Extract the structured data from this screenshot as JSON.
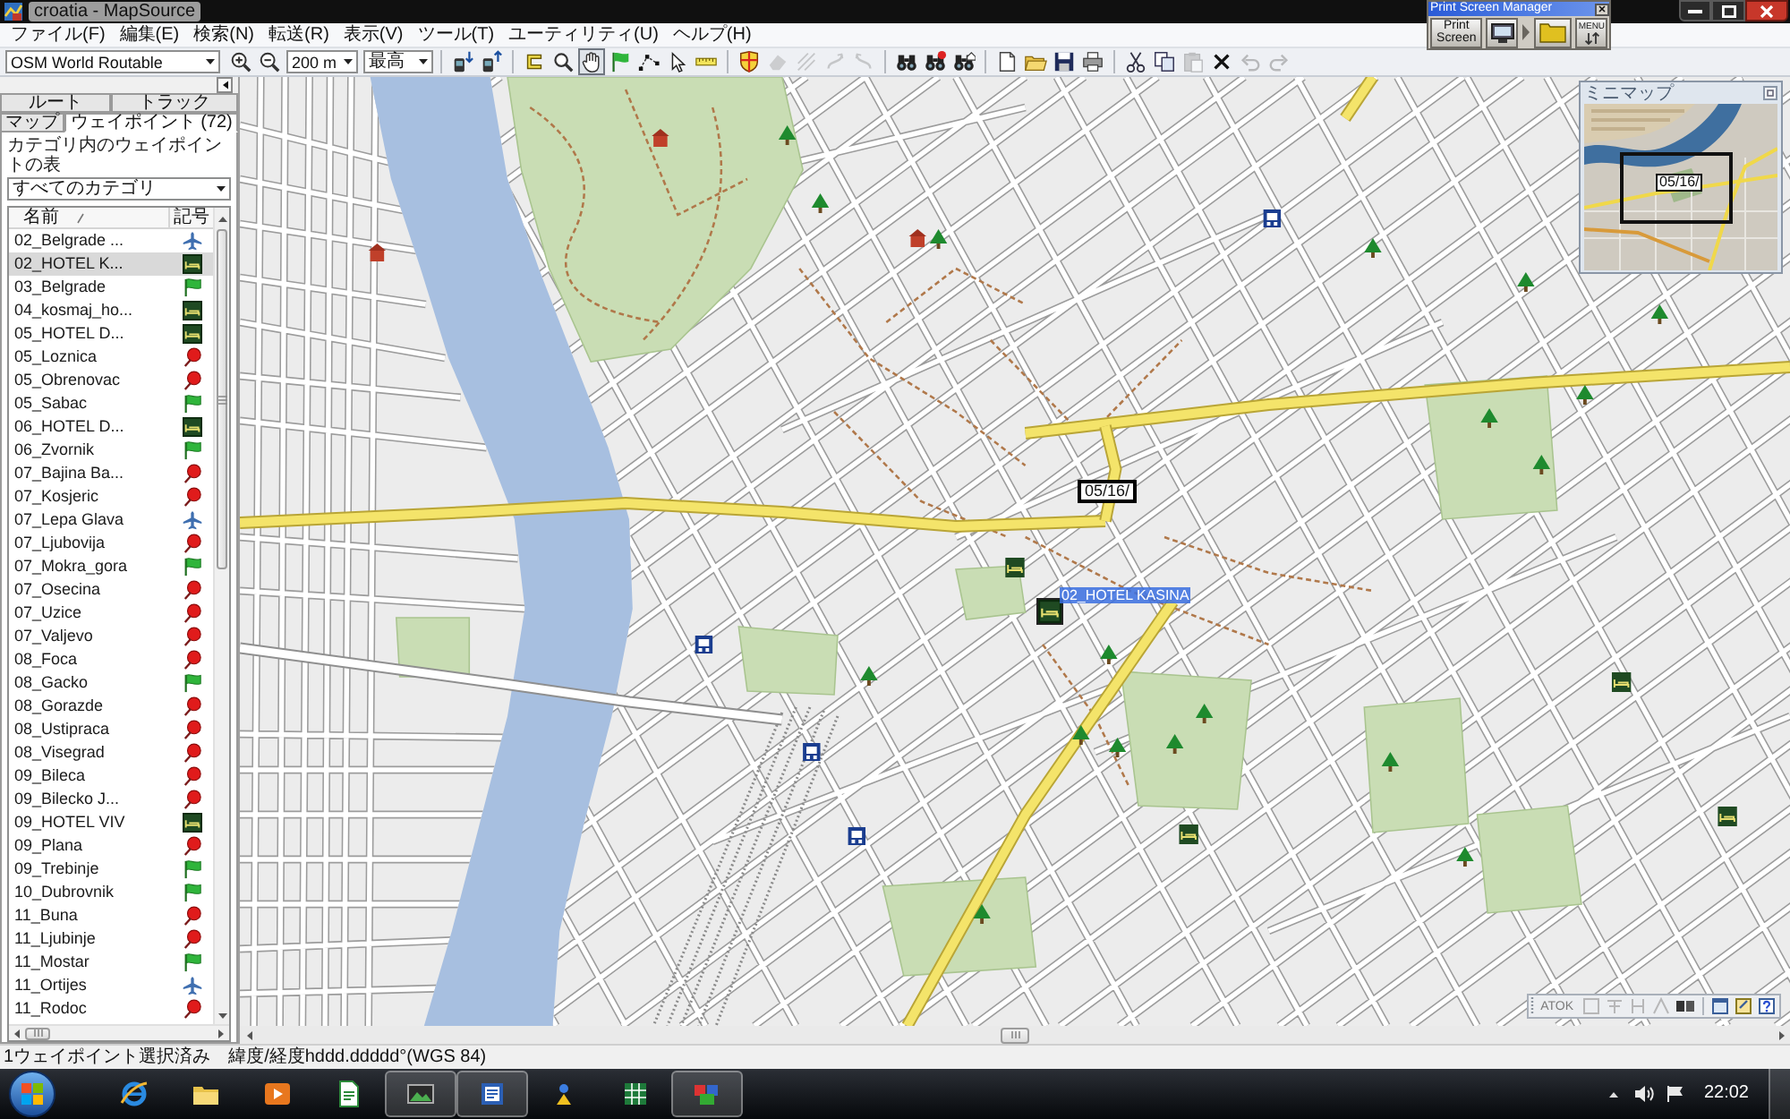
{
  "window": {
    "title": "croatia - MapSource"
  },
  "print_screen_manager": {
    "title": "Print Screen Manager",
    "button": "Print Screen",
    "menu_button": "MENU"
  },
  "menu": [
    "ファイル(F)",
    "編集(E)",
    "検索(N)",
    "転送(R)",
    "表示(V)",
    "ツール(T)",
    "ユーティリティ(U)",
    "ヘルプ(H)"
  ],
  "toolbar": {
    "map_product": "OSM World Routable",
    "zoom_scale": "200 m",
    "detail": "最高",
    "tools": [
      {
        "kind": "select",
        "selected": false
      },
      {
        "kind": "zoom",
        "selected": false
      },
      {
        "kind": "pan",
        "selected": true
      },
      {
        "kind": "waypoint",
        "selected": false
      },
      {
        "kind": "route",
        "selected": false
      },
      {
        "kind": "pointer",
        "selected": false
      },
      {
        "kind": "measure",
        "selected": false
      }
    ],
    "actions": [
      [
        {
          "kind": "map-select",
          "disabled": false
        },
        {
          "kind": "erase",
          "disabled": true
        },
        {
          "kind": "hatch",
          "disabled": true
        },
        {
          "kind": "curve",
          "disabled": true
        },
        {
          "kind": "curve-back",
          "disabled": true
        }
      ],
      [
        {
          "kind": "find",
          "disabled": false
        },
        {
          "kind": "find-place",
          "disabled": false
        },
        {
          "kind": "find-address",
          "disabled": false
        }
      ],
      [
        {
          "kind": "new",
          "disabled": false
        },
        {
          "kind": "open",
          "disabled": false
        },
        {
          "kind": "save",
          "disabled": false
        },
        {
          "kind": "print",
          "disabled": false
        }
      ],
      [
        {
          "kind": "cut",
          "disabled": false
        },
        {
          "kind": "copy",
          "disabled": false
        },
        {
          "kind": "paste",
          "disabled": true
        },
        {
          "kind": "delete",
          "disabled": false
        },
        {
          "kind": "undo",
          "disabled": true
        },
        {
          "kind": "redo",
          "disabled": true
        }
      ]
    ]
  },
  "sidebar": {
    "tabs": [
      [
        {
          "label": "ルート",
          "selected": false
        },
        {
          "label": "トラック",
          "selected": false
        }
      ],
      [
        {
          "label": "マップ",
          "selected": false
        },
        {
          "label": "ウェイポイント (72)",
          "selected": true
        }
      ]
    ],
    "category_label": "カテゴリ内のウェイポイントの表",
    "category": "すべてのカテゴリ",
    "columns": [
      "名前",
      "記号"
    ],
    "waypoints": [
      {
        "name": "02_Belgrade ...",
        "kind": "airport",
        "selected": false
      },
      {
        "name": "02_HOTEL K...",
        "kind": "lodging",
        "selected": true
      },
      {
        "name": "03_Belgrade",
        "kind": "flag",
        "selected": false
      },
      {
        "name": "04_kosmaj_ho...",
        "kind": "lodging",
        "selected": false
      },
      {
        "name": "05_HOTEL D...",
        "kind": "lodging",
        "selected": false
      },
      {
        "name": "05_Loznica",
        "kind": "pin",
        "selected": false
      },
      {
        "name": "05_Obrenovac",
        "kind": "pin",
        "selected": false
      },
      {
        "name": "05_Sabac",
        "kind": "flag",
        "selected": false
      },
      {
        "name": "06_HOTEL D...",
        "kind": "lodging",
        "selected": false
      },
      {
        "name": "06_Zvornik",
        "kind": "flag",
        "selected": false
      },
      {
        "name": "07_Bajina Ba...",
        "kind": "pin",
        "selected": false
      },
      {
        "name": "07_Kosjeric",
        "kind": "pin",
        "selected": false
      },
      {
        "name": "07_Lepa Glava",
        "kind": "airport",
        "selected": false
      },
      {
        "name": "07_Ljubovija",
        "kind": "pin",
        "selected": false
      },
      {
        "name": "07_Mokra_gora",
        "kind": "flag",
        "selected": false
      },
      {
        "name": "07_Osecina",
        "kind": "pin",
        "selected": false
      },
      {
        "name": "07_Uzice",
        "kind": "pin",
        "selected": false
      },
      {
        "name": "07_Valjevo",
        "kind": "pin",
        "selected": false
      },
      {
        "name": "08_Foca",
        "kind": "pin",
        "selected": false
      },
      {
        "name": "08_Gacko",
        "kind": "flag",
        "selected": false
      },
      {
        "name": "08_Gorazde",
        "kind": "pin",
        "selected": false
      },
      {
        "name": "08_Ustipraca",
        "kind": "pin",
        "selected": false
      },
      {
        "name": "08_Visegrad",
        "kind": "pin",
        "selected": false
      },
      {
        "name": "09_Bileca",
        "kind": "pin",
        "selected": false
      },
      {
        "name": "09_Bilecko J...",
        "kind": "pin",
        "selected": false
      },
      {
        "name": "09_HOTEL VIV",
        "kind": "lodging",
        "selected": false
      },
      {
        "name": "09_Plana",
        "kind": "pin",
        "selected": false
      },
      {
        "name": "09_Trebinje",
        "kind": "flag",
        "selected": false
      },
      {
        "name": "10_Dubrovnik",
        "kind": "flag",
        "selected": false
      },
      {
        "name": "11_Buna",
        "kind": "pin",
        "selected": false
      },
      {
        "name": "11_Ljubinje",
        "kind": "pin",
        "selected": false
      },
      {
        "name": "11_Mostar",
        "kind": "flag",
        "selected": false
      },
      {
        "name": "11_Ortijes",
        "kind": "airport",
        "selected": false
      },
      {
        "name": "11_Rodoc",
        "kind": "pin",
        "selected": false
      }
    ]
  },
  "map": {
    "callout": "05/16/",
    "selected_waypoint": {
      "label": "02_HOTEL KASINA",
      "kind": "lodging"
    }
  },
  "minimap": {
    "title": "ミニマップ",
    "callout": "05/16/"
  },
  "language_bar": {
    "label": "ATOK"
  },
  "status_bar": [
    "1ウェイポイント選択済み",
    "緯度/経度hddd.ddddd°(WGS 84)"
  ],
  "taskbar": {
    "apps": [
      {
        "kind": "browser",
        "running": false
      },
      {
        "kind": "folder",
        "running": false
      },
      {
        "kind": "media",
        "running": false
      },
      {
        "kind": "document",
        "running": false
      },
      {
        "kind": "photo",
        "running": true
      },
      {
        "kind": "word",
        "running": true
      },
      {
        "kind": "tool",
        "running": false
      },
      {
        "kind": "spreadsheet",
        "running": false
      },
      {
        "kind": "map-app",
        "running": true
      }
    ],
    "clock": "22:02"
  }
}
